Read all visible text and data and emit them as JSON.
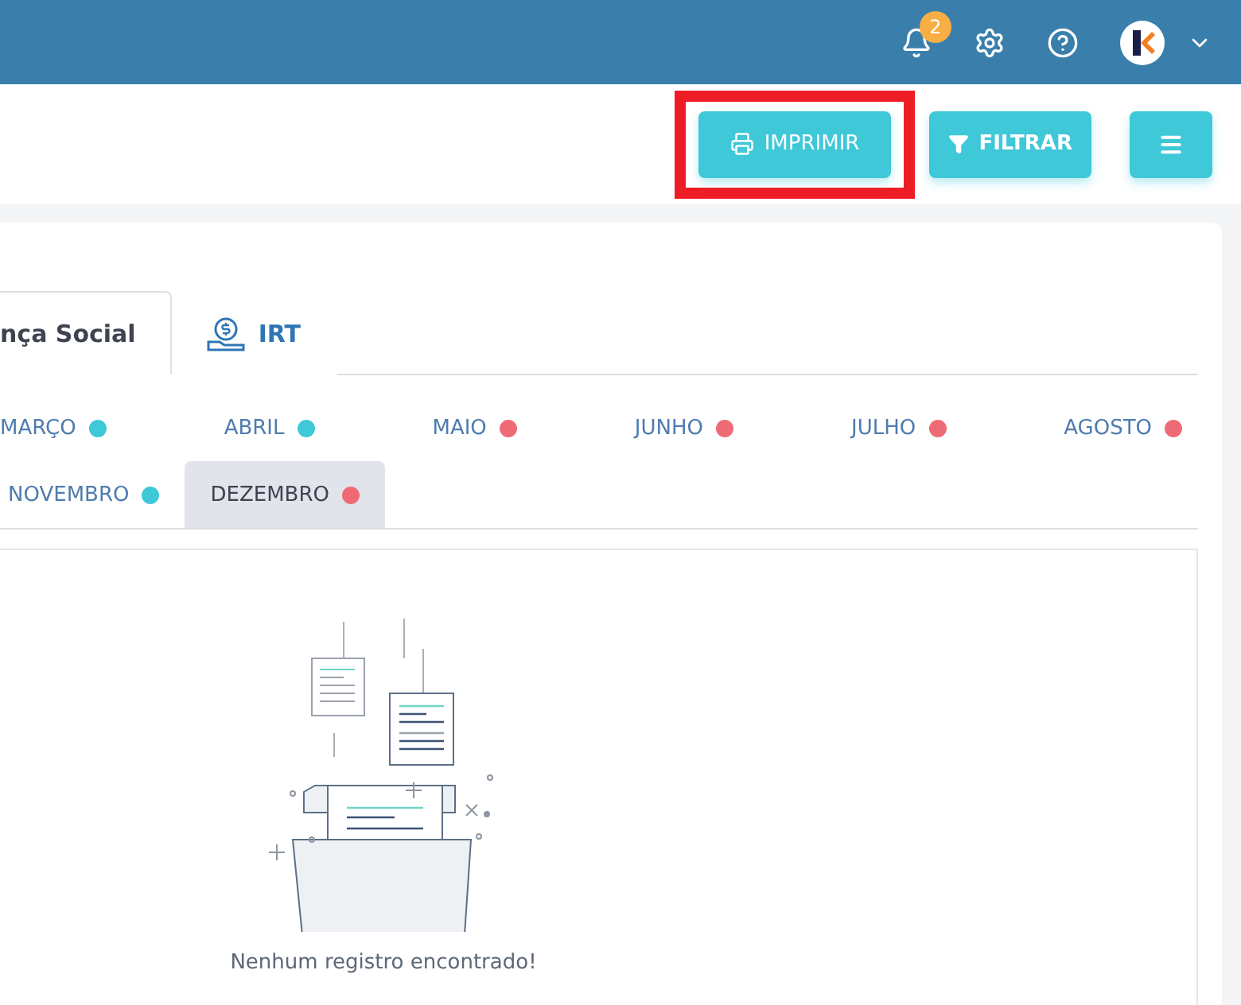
{
  "top_bar": {
    "notifications_count": "2"
  },
  "actions": [
    {
      "kind": "print",
      "label": "IMPRIMIR",
      "highlighted": true
    },
    {
      "kind": "filter",
      "label": "FILTRAR",
      "highlighted": false
    },
    {
      "kind": "menu",
      "highlighted": false
    }
  ],
  "tabs": [
    {
      "label": "nça Social",
      "selected": true,
      "kind": "text"
    },
    {
      "label": "IRT",
      "selected": false,
      "kind": "money"
    }
  ],
  "months": [
    [
      {
        "label": "MARÇO",
        "color": "#3ec8d8",
        "selected": false
      },
      {
        "label": "ABRIL",
        "color": "#3ec8d8",
        "selected": false
      },
      {
        "label": "MAIO",
        "color": "#ee6b76",
        "selected": false
      },
      {
        "label": "JUNHO",
        "color": "#ee6b76",
        "selected": false
      },
      {
        "label": "JULHO",
        "color": "#ee6b76",
        "selected": false
      },
      {
        "label": "AGOSTO",
        "color": "#ee6b76",
        "selected": false
      }
    ],
    [
      {
        "label": "NOVEMBRO",
        "color": "#3ec8d8",
        "selected": false
      },
      {
        "label": "DEZEMBRO",
        "color": "#ee6b76",
        "selected": true
      }
    ]
  ],
  "empty_state": {
    "message": "Nenhum registro encontrado!"
  }
}
